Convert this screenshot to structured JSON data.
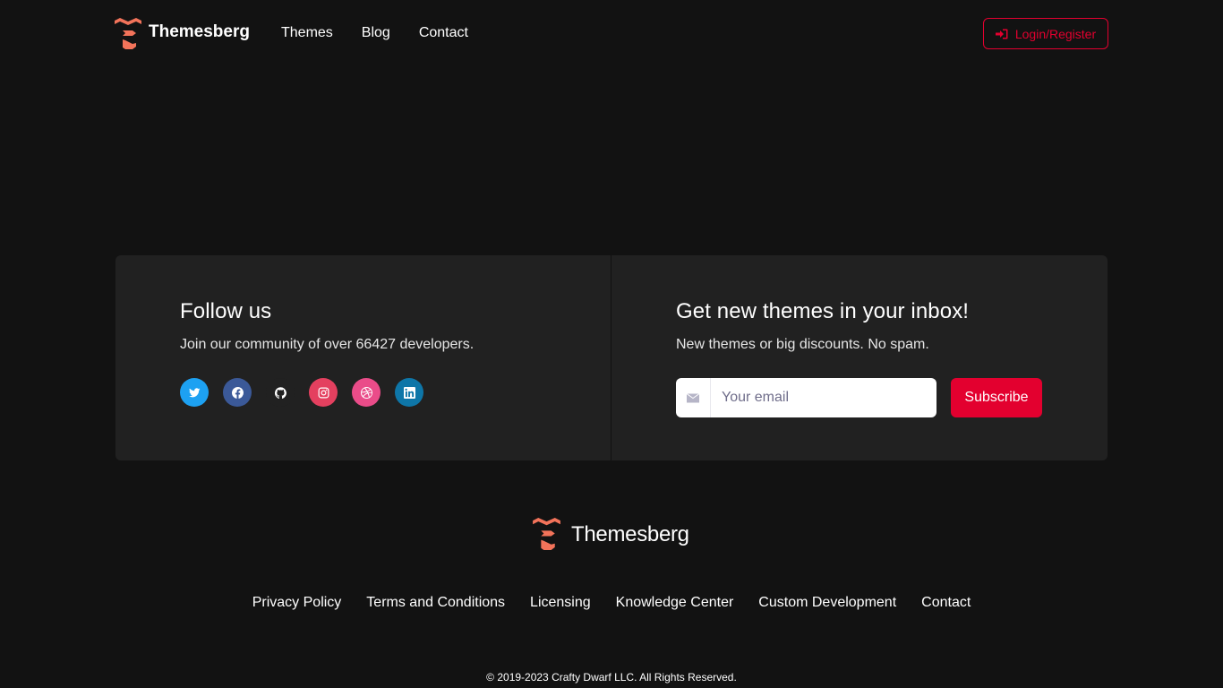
{
  "header": {
    "brand": "Themesberg",
    "nav": [
      "Themes",
      "Blog",
      "Contact"
    ],
    "login_label": "Login/Register",
    "login_icon": "sign-in-icon"
  },
  "follow": {
    "title": "Follow us",
    "subtitle": "Join our community of over 66427 developers.",
    "socials": [
      {
        "name": "twitter",
        "color": "#1da1f2"
      },
      {
        "name": "facebook",
        "color": "#3b5998"
      },
      {
        "name": "github",
        "color": "#212121"
      },
      {
        "name": "instagram",
        "color": "#e4405f"
      },
      {
        "name": "dribbble",
        "color": "#ea4c89"
      },
      {
        "name": "linkedin",
        "color": "#0e76a8"
      }
    ]
  },
  "newsletter": {
    "title": "Get new themes in your inbox!",
    "subtitle": "New themes or big discounts. No spam.",
    "email_placeholder": "Your email",
    "email_value": "",
    "subscribe_label": "Subscribe"
  },
  "footer": {
    "brand": "Themesberg",
    "links": [
      "Privacy Policy",
      "Terms and Conditions",
      "Licensing",
      "Knowledge Center",
      "Custom Development",
      "Contact"
    ],
    "copyright": "© 2019-2023 Crafty Dwarf LLC. All Rights Reserved."
  },
  "colors": {
    "background": "#121212",
    "card": "#212121",
    "accent": "#e3002f",
    "logo": "#f2735a"
  }
}
